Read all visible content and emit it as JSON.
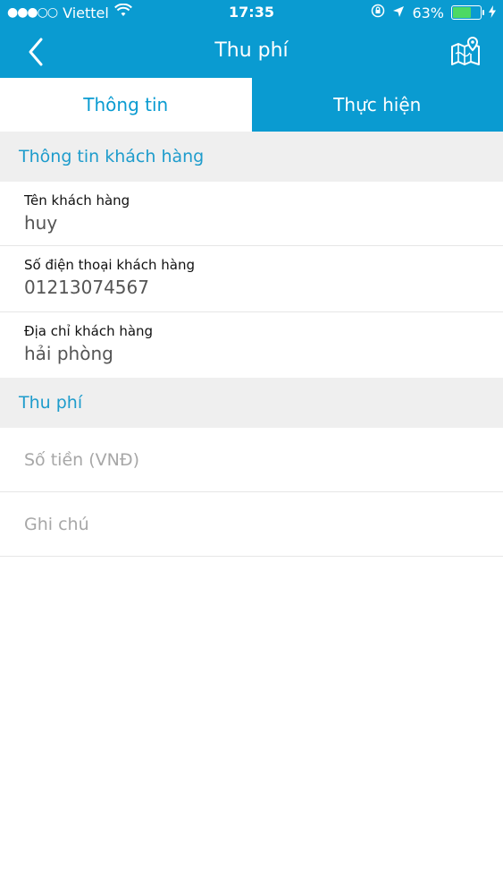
{
  "status_bar": {
    "signal": "●●●○○",
    "carrier": "Viettel",
    "time": "17:35",
    "battery_percent": "63%",
    "battery_level": 0.63
  },
  "nav": {
    "title": "Thu phí"
  },
  "tabs": [
    {
      "label": "Thông tin",
      "active": true
    },
    {
      "label": "Thực hiện",
      "active": false
    }
  ],
  "customer_section": {
    "header": "Thông tin khách hàng",
    "fields": [
      {
        "label": "Tên khách hàng",
        "value": "huy"
      },
      {
        "label": "Số điện thoại khách hàng",
        "value": "01213074567"
      },
      {
        "label": "Địa chỉ khách hàng",
        "value": "hải phòng"
      }
    ]
  },
  "fee_section": {
    "header": "Thu phí",
    "amount_placeholder": "Số tiền (VNĐ)",
    "amount_value": "",
    "note_placeholder": "Ghi chú",
    "note_value": ""
  },
  "colors": {
    "primary": "#0a9bd1",
    "section_bg": "#efefef",
    "section_text": "#1e9ccc",
    "battery_fill": "#4cd964"
  }
}
